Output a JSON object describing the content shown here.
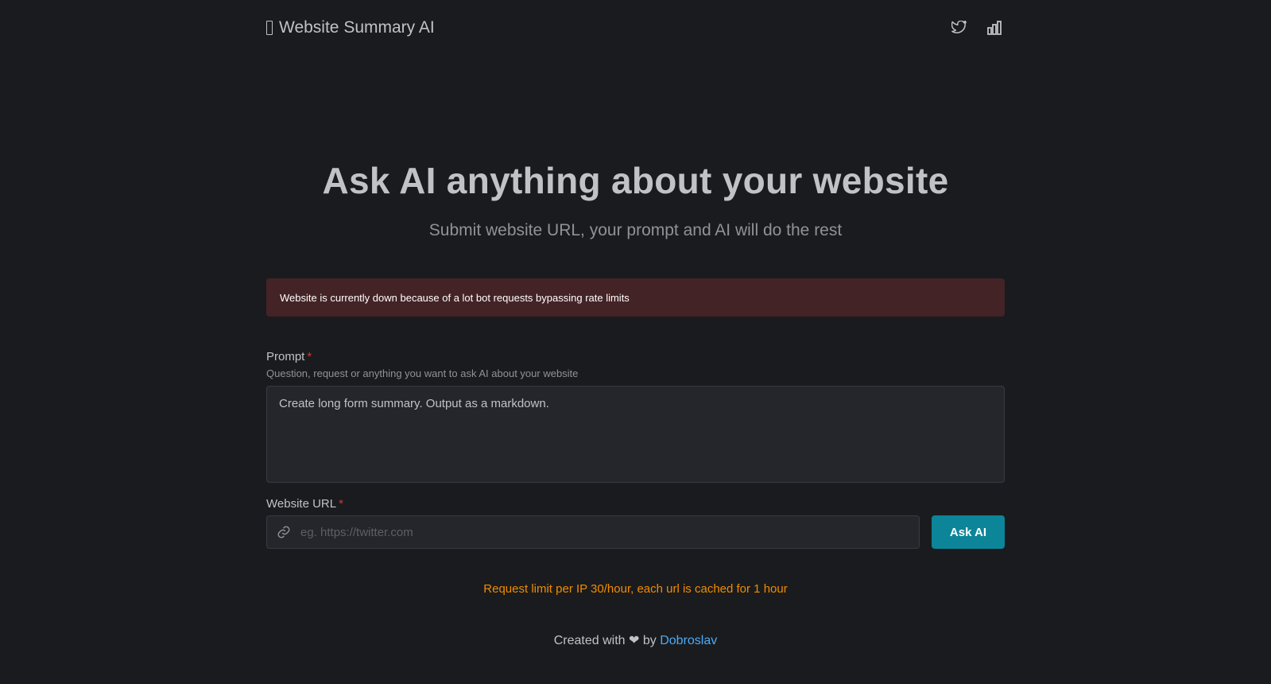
{
  "header": {
    "brand": "Website Summary AI",
    "icons": [
      "twitter-icon",
      "bar-chart-icon"
    ]
  },
  "hero": {
    "title": "Ask AI anything about your website",
    "subtitle": "Submit website URL, your prompt and AI will do the rest"
  },
  "alert": {
    "text": "Website is currently down because of a lot bot requests bypassing rate limits"
  },
  "form": {
    "prompt_label": "Prompt",
    "required_mark": "*",
    "prompt_description": "Question, request or anything you want to ask AI about your website",
    "prompt_value": "Create long form summary. Output as a markdown.",
    "url_label": "Website URL",
    "url_placeholder": "eg. https://twitter.com",
    "url_value": "",
    "submit_label": "Ask AI"
  },
  "limit_note": "Request limit per IP 30/hour, each url is cached for 1 hour",
  "footer": {
    "prefix": "Created with ❤ by ",
    "author": "Dobroslav"
  },
  "colors": {
    "background": "#1a1b1e",
    "alert_bg": "#442326",
    "accent": "#0c8599",
    "warning": "#f08c00",
    "link": "#4dabf7"
  }
}
